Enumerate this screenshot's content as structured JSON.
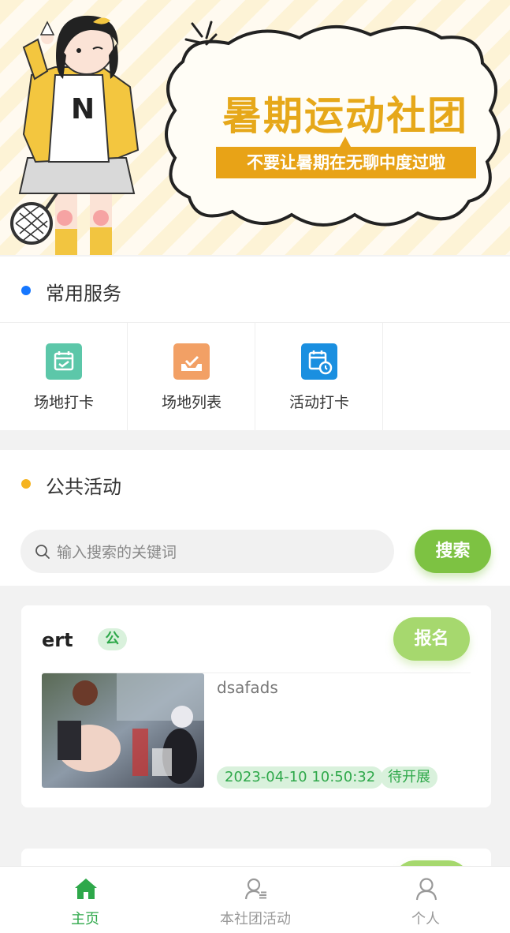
{
  "banner": {
    "title": "暑期运动社团",
    "subtitle": "不要让暑期在无聊中度过啦"
  },
  "common_services": {
    "title": "常用服务",
    "dot_color": "#1677ff",
    "items": [
      {
        "label": "场地打卡",
        "icon": "calendar-check-icon",
        "color": "#5cc7a9"
      },
      {
        "label": "场地列表",
        "icon": "list-inbox-icon",
        "color": "#f2a065"
      },
      {
        "label": "活动打卡",
        "icon": "calendar-clock-icon",
        "color": "#1a8fe0"
      }
    ]
  },
  "public_activities": {
    "title": "公共活动",
    "dot_color": "#f5b320",
    "search": {
      "placeholder": "输入搜索的关键词",
      "button_label": "搜索"
    },
    "cards": [
      {
        "title": "ert",
        "badge": "公",
        "button_label": "报名",
        "description": "dsafads",
        "date": "2023-04-10 10:50:32",
        "status": "待开展"
      }
    ]
  },
  "tabbar": {
    "items": [
      {
        "label": "主页",
        "icon": "home-icon",
        "active": true
      },
      {
        "label": "本社团活动",
        "icon": "user-list-icon",
        "active": false
      },
      {
        "label": "个人",
        "icon": "person-icon",
        "active": false
      }
    ]
  },
  "colors": {
    "accent_green": "#7dc242",
    "active_tab": "#2ea84a",
    "banner_yellow": "#e8a317"
  }
}
